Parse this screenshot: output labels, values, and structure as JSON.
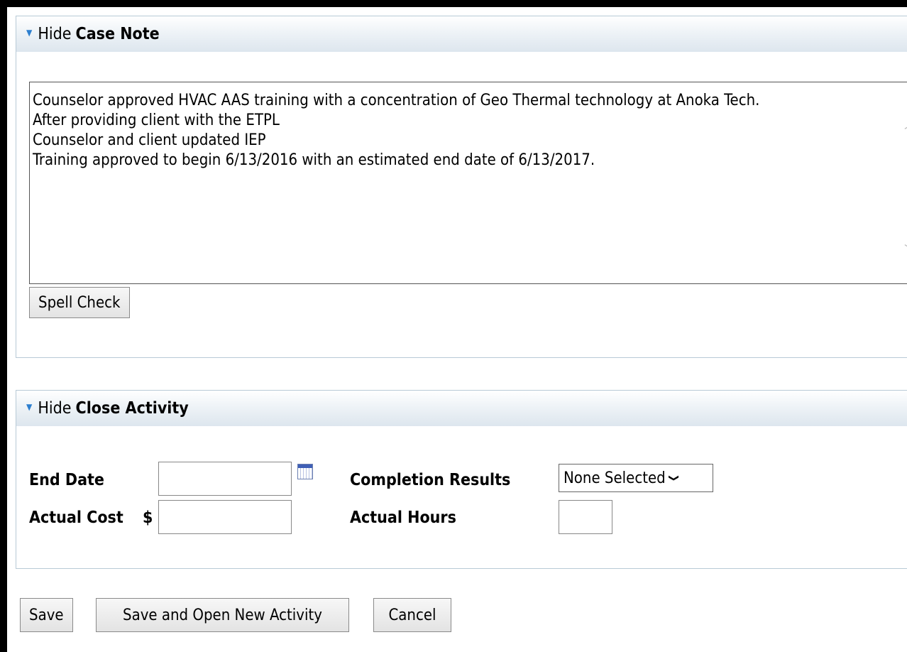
{
  "case_note": {
    "toggle_label": "Hide",
    "title": "Case Note",
    "text": "Counselor approved HVAC AAS training with a concentration of Geo Thermal technology at Anoka Tech.\nAfter providing client with the ETPL\nCounselor and client updated IEP\nTraining approved to begin 6/13/2016 with an estimated end date of 6/13/2017.",
    "spell_check_label": "Spell Check"
  },
  "close_activity": {
    "toggle_label": "Hide",
    "title": "Close Activity",
    "end_date_label": "End Date",
    "end_date_value": "",
    "actual_cost_label": "Actual Cost",
    "currency_symbol": "$",
    "actual_cost_value": "",
    "completion_results_label": "Completion Results",
    "completion_results_value": "None Selected",
    "actual_hours_label": "Actual Hours",
    "actual_hours_value": ""
  },
  "actions": {
    "save_label": "Save",
    "save_new_label": "Save and Open New Activity",
    "cancel_label": "Cancel"
  },
  "colors": {
    "toggle_triangle": "#2d7fcf",
    "panel_border": "#b8cad6",
    "outer_frame": "#000000"
  }
}
